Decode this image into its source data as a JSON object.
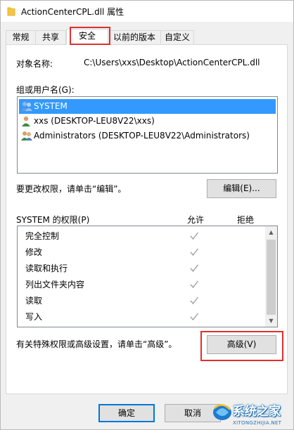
{
  "window": {
    "title": "ActionCenterCPL.dll 属性",
    "file_icon": "folder-icon"
  },
  "tabs": [
    {
      "label": "常规",
      "active": false
    },
    {
      "label": "共享",
      "active": false
    },
    {
      "label": "安全",
      "active": true
    },
    {
      "label": "以前的版本",
      "active": false
    },
    {
      "label": "自定义",
      "active": false
    }
  ],
  "security": {
    "object_name_label": "对象名称:",
    "object_name_value": "C:\\Users\\xxs\\Desktop\\ActionCenterCPL.dll",
    "group_label": "组或用户名(G):",
    "users": [
      {
        "name": "SYSTEM",
        "icon": "user-group-icon",
        "selected": true
      },
      {
        "name": "xxs (DESKTOP-LEU8V22\\xxs)",
        "icon": "user-icon",
        "selected": false
      },
      {
        "name": "Administrators (DESKTOP-LEU8V22\\Administrators)",
        "icon": "user-group-icon",
        "selected": false
      }
    ],
    "edit_hint": "要更改权限，请单击“编辑”。",
    "edit_button": "编辑(E)...",
    "perm_label": "SYSTEM 的权限(P)",
    "allow_header": "允许",
    "deny_header": "拒绝",
    "permissions": [
      {
        "name": "完全控制",
        "allow": true,
        "deny": false
      },
      {
        "name": "修改",
        "allow": true,
        "deny": false
      },
      {
        "name": "读取和执行",
        "allow": true,
        "deny": false
      },
      {
        "name": "列出文件夹内容",
        "allow": true,
        "deny": false
      },
      {
        "name": "读取",
        "allow": true,
        "deny": false
      },
      {
        "name": "写入",
        "allow": true,
        "deny": false
      }
    ],
    "advanced_hint": "有关特殊权限或高级设置，请单击“高级”。",
    "advanced_button": "高级(V)"
  },
  "footer": {
    "ok_button": "确定",
    "cancel_button": "取消"
  },
  "watermark": {
    "text": "系统之家",
    "url": "XITONGZHIJIA.NET"
  },
  "colors": {
    "selection": "#3399ff",
    "highlight_box": "#e0302e",
    "check_mark": "#a0a0a0"
  }
}
